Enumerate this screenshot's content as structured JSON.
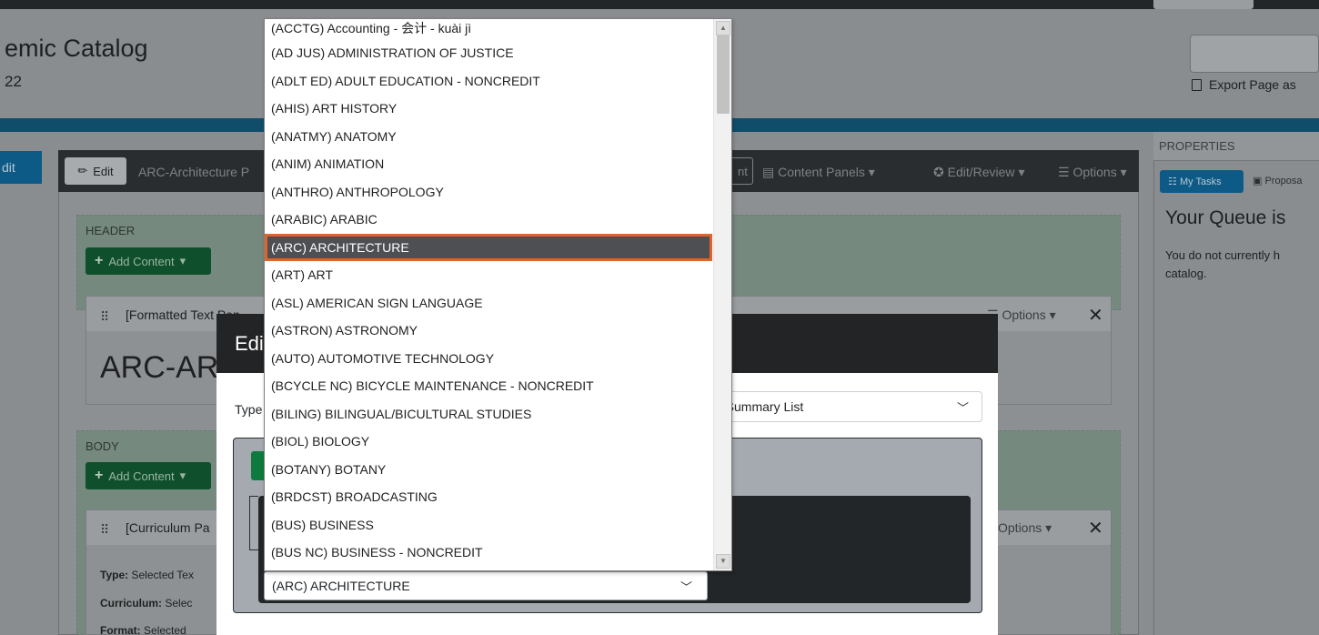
{
  "page": {
    "title": "emic Catalog",
    "subtitle": "22",
    "export_label": "Export Page as",
    "left_edit_label": "dit"
  },
  "toolbar": {
    "edit_label": "Edit",
    "breadcrumb": "ARC-Architecture P",
    "hint_label": "nt",
    "content_panels_label": "Content Panels",
    "edit_review_label": "Edit/Review",
    "options_label": "Options"
  },
  "header_region": {
    "label": "HEADER",
    "add_content_label": "Add Content",
    "panel_title": "[Formatted Text Pan",
    "panel_options_label": "Options",
    "big_heading": "ARC-ARC"
  },
  "body_region": {
    "label": "BODY",
    "add_content_label": "Add Content",
    "panel_title": "[Curriculum Pa",
    "panel_options_label": "Options",
    "fields": [
      {
        "label": "Type:",
        "value": "Selected Tex"
      },
      {
        "label": "Curriculum:",
        "value": "Selec"
      },
      {
        "label": "Format:",
        "value": "Selected"
      }
    ]
  },
  "properties": {
    "header": "PROPERTIES",
    "my_tasks_label": "My Tasks",
    "proposals_label": "Proposa",
    "queue_title": "Your Queue is",
    "queue_text": "You do not currently h catalog."
  },
  "modal": {
    "title": "Edit",
    "type_label": "Type",
    "type_value": "e Summary List",
    "subject_value": "(ARC) ARCHITECTURE"
  },
  "dropdown": {
    "selected_index": 8,
    "options": [
      "(ACCTG) Accounting - 会计 - kuài jì",
      "(AD JUS) ADMINISTRATION OF JUSTICE",
      "(ADLT ED) ADULT EDUCATION - NONCREDIT",
      "(AHIS) ART HISTORY",
      "(ANATMY) ANATOMY",
      "(ANIM) ANIMATION",
      "(ANTHRO) ANTHROPOLOGY",
      "(ARABIC) ARABIC",
      "(ARC) ARCHITECTURE",
      "(ART) ART",
      "(ASL) AMERICAN SIGN LANGUAGE",
      "(ASTRON) ASTRONOMY",
      "(AUTO) AUTOMOTIVE TECHNOLOGY",
      "(BCYCLE NC) BICYCLE MAINTENANCE - NONCREDIT",
      "(BILING) BILINGUAL/BICULTURAL STUDIES",
      "(BIOL) BIOLOGY",
      "(BOTANY) BOTANY",
      "(BRDCST) BROADCASTING",
      "(BUS) BUSINESS",
      "(BUS NC) BUSINESS - NONCREDIT"
    ]
  }
}
